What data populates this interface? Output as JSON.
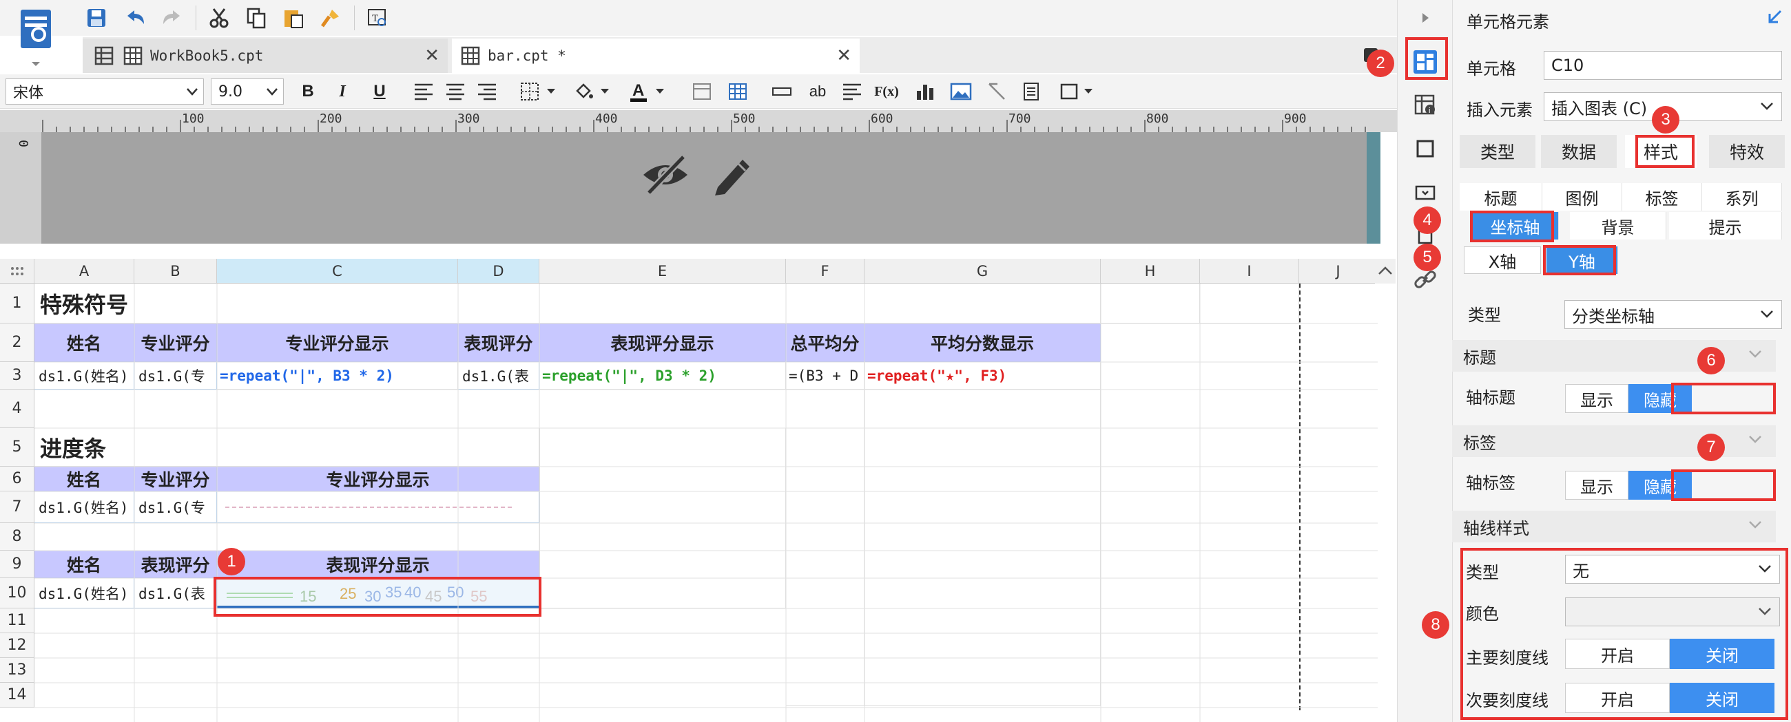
{
  "colors": {
    "accent": "#3d8ff0",
    "header_fill": "#c8c8ff",
    "annotation": "#e8312f"
  },
  "file_tabs": [
    {
      "label": "WorkBook5.cpt",
      "icon": "grid-icon"
    },
    {
      "label": "bar.cpt *",
      "icon": "report-icon"
    }
  ],
  "format_bar": {
    "font": "宋体",
    "size": "9.0",
    "bold": "B",
    "italic": "I",
    "underline": "U",
    "text_tool": "ab",
    "fx": "F(x)"
  },
  "ruler": {
    "origin": "0",
    "marks": [
      "100",
      "200",
      "300",
      "400",
      "500",
      "600",
      "700",
      "800",
      "900"
    ]
  },
  "columns": [
    "A",
    "B",
    "C",
    "D",
    "E",
    "F",
    "G",
    "H",
    "I",
    "J"
  ],
  "rows": [
    "1",
    "2",
    "3",
    "4",
    "5",
    "6",
    "7",
    "8",
    "9",
    "10",
    "11",
    "12",
    "13",
    "14"
  ],
  "sheet": {
    "r1_title": "特殊符号",
    "r2": {
      "a": "姓名",
      "b": "专业评分",
      "c": "专业评分显示",
      "d": "表现评分",
      "e": "表现评分显示",
      "f": "总平均分",
      "g": "平均分数显示"
    },
    "r3": {
      "a": "ds1.G(姓名)",
      "b": "ds1.G(专",
      "c": "=repeat(\"|\", B3 * 2)",
      "d": "ds1.G(表",
      "e": "=repeat(\"|\", D3 * 2)",
      "f": "=(B3 + D",
      "g": "=repeat(\"★\", F3)"
    },
    "r5_title": "进度条",
    "r6": {
      "a": "姓名",
      "b": "专业评分",
      "c": "专业评分显示"
    },
    "r7": {
      "a": "ds1.G(姓名)",
      "b": "ds1.G(专"
    },
    "r9": {
      "a": "姓名",
      "b": "表现评分",
      "c": "表现评分显示"
    },
    "r10": {
      "a": "ds1.G(姓名)",
      "b": "ds1.G(表",
      "chart_ticks": [
        "15",
        "25",
        "30",
        "35",
        "40",
        "45",
        "50",
        "55"
      ]
    }
  },
  "panel": {
    "title": "单元格元素",
    "cell_label": "单元格",
    "cell_value": "C10",
    "insert_label": "插入元素",
    "insert_value": "插入图表 (C)",
    "main_tabs": [
      "类型",
      "数据",
      "样式",
      "特效"
    ],
    "sub_tabs_row1": [
      "标题",
      "图例",
      "标签",
      "系列"
    ],
    "sub_tabs_row2": [
      "坐标轴",
      "背景",
      "提示"
    ],
    "axis_tabs": [
      "X轴",
      "Y轴"
    ],
    "type_label": "类型",
    "type_value": "分类坐标轴",
    "sec_title": "标题",
    "axis_title_label": "轴标题",
    "show": "显示",
    "hide": "隐藏",
    "sec_label": "标签",
    "axis_label_label": "轴标签",
    "sec_axisline": "轴线样式",
    "line_type_label": "类型",
    "line_type_value": "无",
    "color_label": "颜色",
    "major_tick_label": "主要刻度线",
    "minor_tick_label": "次要刻度线",
    "on": "开启",
    "off": "关闭"
  },
  "badges": [
    "1",
    "2",
    "3",
    "4",
    "5",
    "6",
    "7",
    "8"
  ]
}
